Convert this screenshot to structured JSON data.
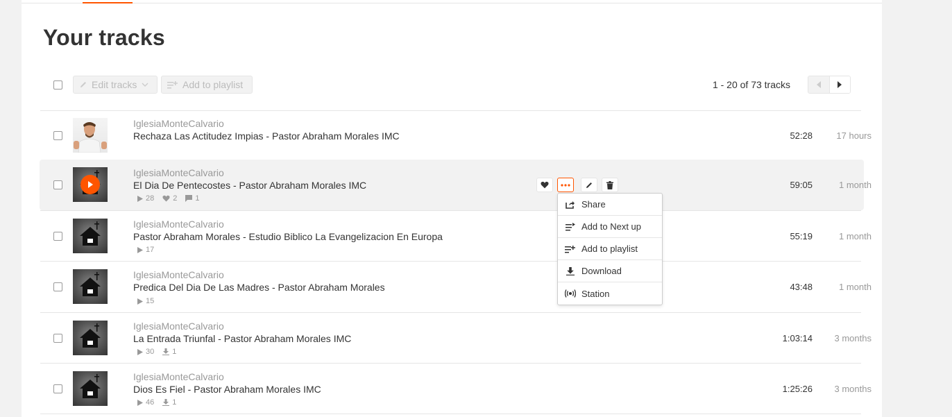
{
  "page": {
    "title": "Your tracks"
  },
  "toolbar": {
    "edit_label": "Edit tracks",
    "add_to_playlist_label": "Add to playlist",
    "pagination_text": "1 - 20 of 73 tracks"
  },
  "tracks": [
    {
      "artist": "IglesiaMonteCalvario",
      "title": "Rechaza Las Actitudez Impias - Pastor Abraham Morales IMC",
      "duration": "52:28",
      "ago": "17 hours",
      "artwork": "person-photo"
    },
    {
      "artist": "IglesiaMonteCalvario",
      "title": "El Dia De Pentecostes - Pastor Abraham Morales IMC",
      "duration": "59:05",
      "ago": "1 month",
      "plays": "28",
      "likes": "2",
      "comments": "1",
      "artwork": "church-logo"
    },
    {
      "artist": "IglesiaMonteCalvario",
      "title": "Pastor Abraham Morales - Estudio Biblico La Evangelizacion En Europa",
      "duration": "55:19",
      "ago": "1 month",
      "plays": "17",
      "artwork": "church-logo"
    },
    {
      "artist": "IglesiaMonteCalvario",
      "title": "Predica Del Dia De Las Madres - Pastor Abraham Morales",
      "duration": "43:48",
      "ago": "1 month",
      "plays": "15",
      "artwork": "church-logo"
    },
    {
      "artist": "IglesiaMonteCalvario",
      "title": "La Entrada Triunfal - Pastor Abraham Morales IMC",
      "duration": "1:03:14",
      "ago": "3 months",
      "plays": "30",
      "downloads": "1",
      "artwork": "church-logo"
    },
    {
      "artist": "IglesiaMonteCalvario",
      "title": "Dios Es Fiel - Pastor Abraham Morales IMC",
      "duration": "1:25:26",
      "ago": "3 months",
      "plays": "46",
      "downloads": "1",
      "artwork": "church-logo"
    }
  ],
  "menu": {
    "items": [
      {
        "label": "Share",
        "icon": "share-icon"
      },
      {
        "label": "Add to Next up",
        "icon": "next-up-icon"
      },
      {
        "label": "Add to playlist",
        "icon": "add-to-playlist-icon"
      },
      {
        "label": "Download",
        "icon": "download-icon"
      },
      {
        "label": "Station",
        "icon": "station-icon"
      }
    ]
  },
  "colors": {
    "accent": "#ff5500",
    "muted": "#999999",
    "text": "#333333"
  }
}
